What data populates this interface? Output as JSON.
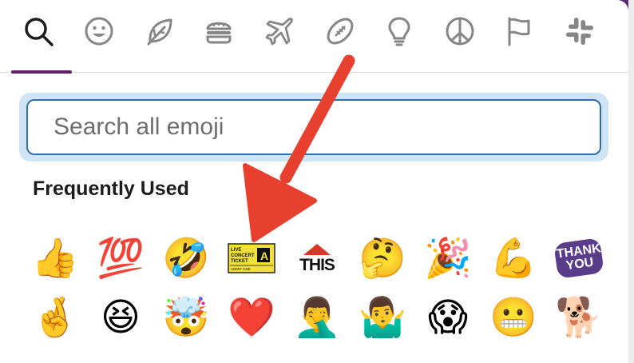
{
  "tabs": [
    {
      "icon": "search-icon"
    },
    {
      "icon": "smiley-icon"
    },
    {
      "icon": "leaf-icon"
    },
    {
      "icon": "burger-icon"
    },
    {
      "icon": "airplane-icon"
    },
    {
      "icon": "football-icon"
    },
    {
      "icon": "lightbulb-icon"
    },
    {
      "icon": "peace-icon"
    },
    {
      "icon": "flag-icon"
    },
    {
      "icon": "slack-icon"
    }
  ],
  "search": {
    "placeholder": "Search all emoji",
    "value": ""
  },
  "section": {
    "title": "Frequently Used"
  },
  "emojis": {
    "row1": [
      {
        "name": "thumbsup",
        "glyph": "👍"
      },
      {
        "name": "hundred",
        "glyph": "💯"
      },
      {
        "name": "rofl",
        "glyph": "🤣"
      },
      {
        "name": "concert-ticket",
        "lines": [
          "LIVE",
          "CONCERT",
          "TICKET"
        ],
        "seat": "A",
        "row": "ADMIT ONE"
      },
      {
        "name": "this",
        "text": "THIS"
      },
      {
        "name": "thinking",
        "glyph": "🤔"
      },
      {
        "name": "party-popper",
        "glyph": "🎉"
      },
      {
        "name": "muscle",
        "glyph": "💪"
      },
      {
        "name": "thank-you",
        "text": "THANK YOU"
      }
    ],
    "row2": [
      {
        "name": "crossed-fingers",
        "glyph": "🤞"
      },
      {
        "name": "laughing",
        "glyph": "😆"
      },
      {
        "name": "exploding-head",
        "glyph": "🤯"
      },
      {
        "name": "heart",
        "glyph": "❤️"
      },
      {
        "name": "facepalm",
        "glyph": "🤦‍♂️"
      },
      {
        "name": "shrug",
        "glyph": "🤷‍♂️"
      },
      {
        "name": "scream",
        "glyph": "😱"
      },
      {
        "name": "trollface",
        "glyph": "😬"
      },
      {
        "name": "doge",
        "glyph": "🐕"
      }
    ]
  },
  "colors": {
    "accent": "#611f69",
    "focus_ring": "#cfe4f4",
    "input_border": "#2f6ea8",
    "arrow": "#e8402e"
  }
}
